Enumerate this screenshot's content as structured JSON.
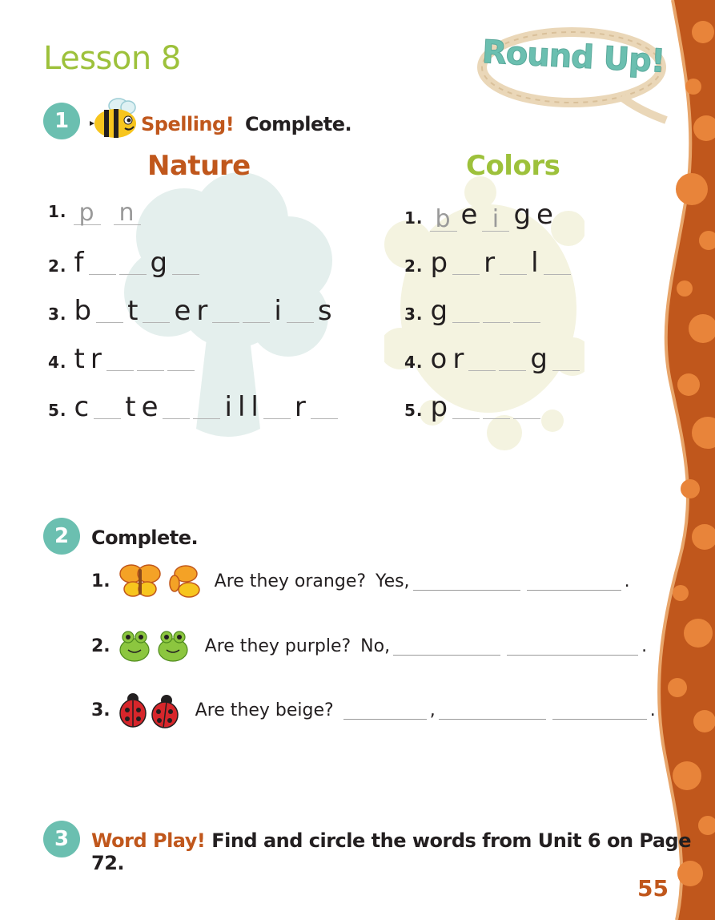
{
  "header": {
    "lesson_title": "Lesson 8",
    "badge_text": "Round Up!"
  },
  "section1": {
    "number": "1",
    "label": "Spelling!",
    "instruction": "Complete.",
    "nature": {
      "heading": "Nature",
      "items": [
        {
          "n": "1.",
          "parts": [
            [
              "b",
              "p"
            ],
            [
              "l"
            ],
            [
              "a"
            ],
            [
              "b",
              "n"
            ],
            [
              "t"
            ],
            [
              "s"
            ]
          ]
        },
        {
          "n": "2.",
          "parts": [
            [
              "l",
              "f"
            ],
            [
              "b",
              ""
            ],
            [
              "b",
              ""
            ],
            [
              "l",
              "g"
            ],
            [
              "b",
              ""
            ]
          ]
        },
        {
          "n": "3.",
          "parts": [
            [
              "l",
              "b"
            ],
            [
              "b",
              ""
            ],
            [
              "l",
              "t"
            ],
            [
              "b",
              ""
            ],
            [
              "l",
              "e"
            ],
            [
              "l",
              "r"
            ],
            [
              "b",
              ""
            ],
            [
              "b",
              ""
            ],
            [
              "l",
              "i"
            ],
            [
              "b",
              ""
            ],
            [
              "l",
              "s"
            ]
          ]
        },
        {
          "n": "4.",
          "parts": [
            [
              "l",
              "t"
            ],
            [
              "l",
              "r"
            ],
            [
              "b",
              ""
            ],
            [
              "b",
              ""
            ],
            [
              "b",
              ""
            ]
          ]
        },
        {
          "n": "5.",
          "parts": [
            [
              "l",
              "c"
            ],
            [
              "b",
              ""
            ],
            [
              "l",
              "t"
            ],
            [
              "l",
              "e"
            ],
            [
              "b",
              ""
            ],
            [
              "b",
              ""
            ],
            [
              "l",
              "i"
            ],
            [
              "l",
              "l"
            ],
            [
              "l",
              "l"
            ],
            [
              "b",
              ""
            ],
            [
              "l",
              "r"
            ],
            [
              "b",
              ""
            ]
          ]
        }
      ]
    },
    "colors": {
      "heading": "Colors",
      "items": [
        {
          "n": "1.",
          "parts": [
            [
              "b",
              "b"
            ],
            [
              "l",
              "e"
            ],
            [
              "b",
              "i"
            ],
            [
              "l",
              "g"
            ],
            [
              "l",
              "e"
            ]
          ]
        },
        {
          "n": "2.",
          "parts": [
            [
              "l",
              "p"
            ],
            [
              "b",
              ""
            ],
            [
              "l",
              "r"
            ],
            [
              "b",
              ""
            ],
            [
              "l",
              "l"
            ],
            [
              "b",
              ""
            ]
          ]
        },
        {
          "n": "3.",
          "parts": [
            [
              "l",
              "g"
            ],
            [
              "b",
              ""
            ],
            [
              "b",
              ""
            ],
            [
              "b",
              ""
            ]
          ]
        },
        {
          "n": "4.",
          "parts": [
            [
              "l",
              "o"
            ],
            [
              "l",
              "r"
            ],
            [
              "b",
              ""
            ],
            [
              "b",
              ""
            ],
            [
              "l",
              "g"
            ],
            [
              "b",
              ""
            ]
          ]
        },
        {
          "n": "5.",
          "parts": [
            [
              "l",
              "p"
            ],
            [
              "b",
              ""
            ],
            [
              "b",
              ""
            ],
            [
              "b",
              ""
            ]
          ]
        }
      ]
    }
  },
  "section2": {
    "number": "2",
    "instruction": "Complete.",
    "items": [
      {
        "n": "1.",
        "question": "Are they orange?",
        "answer_start": "Yes,",
        "end": ".",
        "icon": "butterfly-icon"
      },
      {
        "n": "2.",
        "question": "Are they purple?",
        "answer_start": "No,",
        "end": ".",
        "icon": "frog-icon"
      },
      {
        "n": "3.",
        "question": "Are they beige?",
        "comma": ",",
        "end": ".",
        "icon": "ladybug-icon"
      }
    ]
  },
  "section3": {
    "number": "3",
    "label": "Word Play!",
    "instruction": "Find and circle the words from Unit 6 on Page 72."
  },
  "footer": {
    "page_number": "55"
  },
  "colors": {
    "green": "#9dc13b",
    "teal": "#6bbfb0",
    "orange": "#c0571c",
    "border": "#c0571c"
  }
}
